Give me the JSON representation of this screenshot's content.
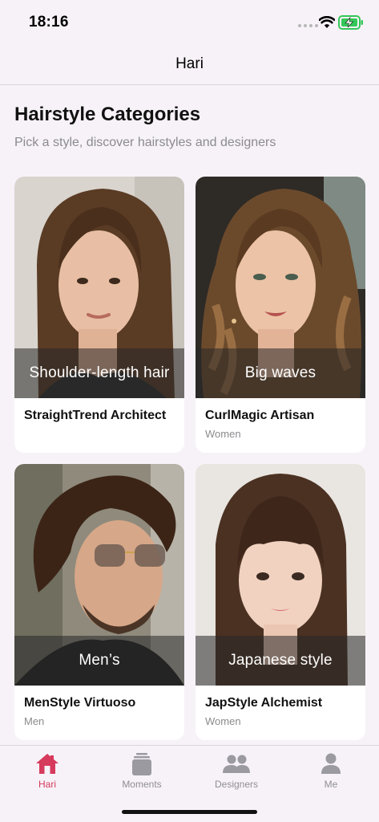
{
  "status_bar": {
    "time": "18:16"
  },
  "nav": {
    "title": "Hari"
  },
  "header": {
    "title": "Hairstyle Categories",
    "subtitle": "Pick a style, discover hairstyles and designers"
  },
  "cards": [
    {
      "style_label": "Shoulder-length hair",
      "designer": "StraightTrend Architect",
      "category": ""
    },
    {
      "style_label": "Big waves",
      "designer": "CurlMagic Artisan",
      "category": "Women"
    },
    {
      "style_label": "Men’s",
      "designer": "MenStyle Virtuoso",
      "category": "Men"
    },
    {
      "style_label": "Japanese style",
      "designer": "JapStyle Alchemist",
      "category": "Women"
    }
  ],
  "tab_bar": {
    "tabs": [
      {
        "label": "Hari",
        "icon": "house-icon",
        "active": true
      },
      {
        "label": "Moments",
        "icon": "moments-icon",
        "active": false
      },
      {
        "label": "Designers",
        "icon": "people-icon",
        "active": false
      },
      {
        "label": "Me",
        "icon": "person-icon",
        "active": false
      }
    ]
  },
  "colors": {
    "accent": "#d63a5c",
    "inactive": "#8e8e93",
    "background": "#f7f2f8",
    "battery": "#34c759"
  }
}
